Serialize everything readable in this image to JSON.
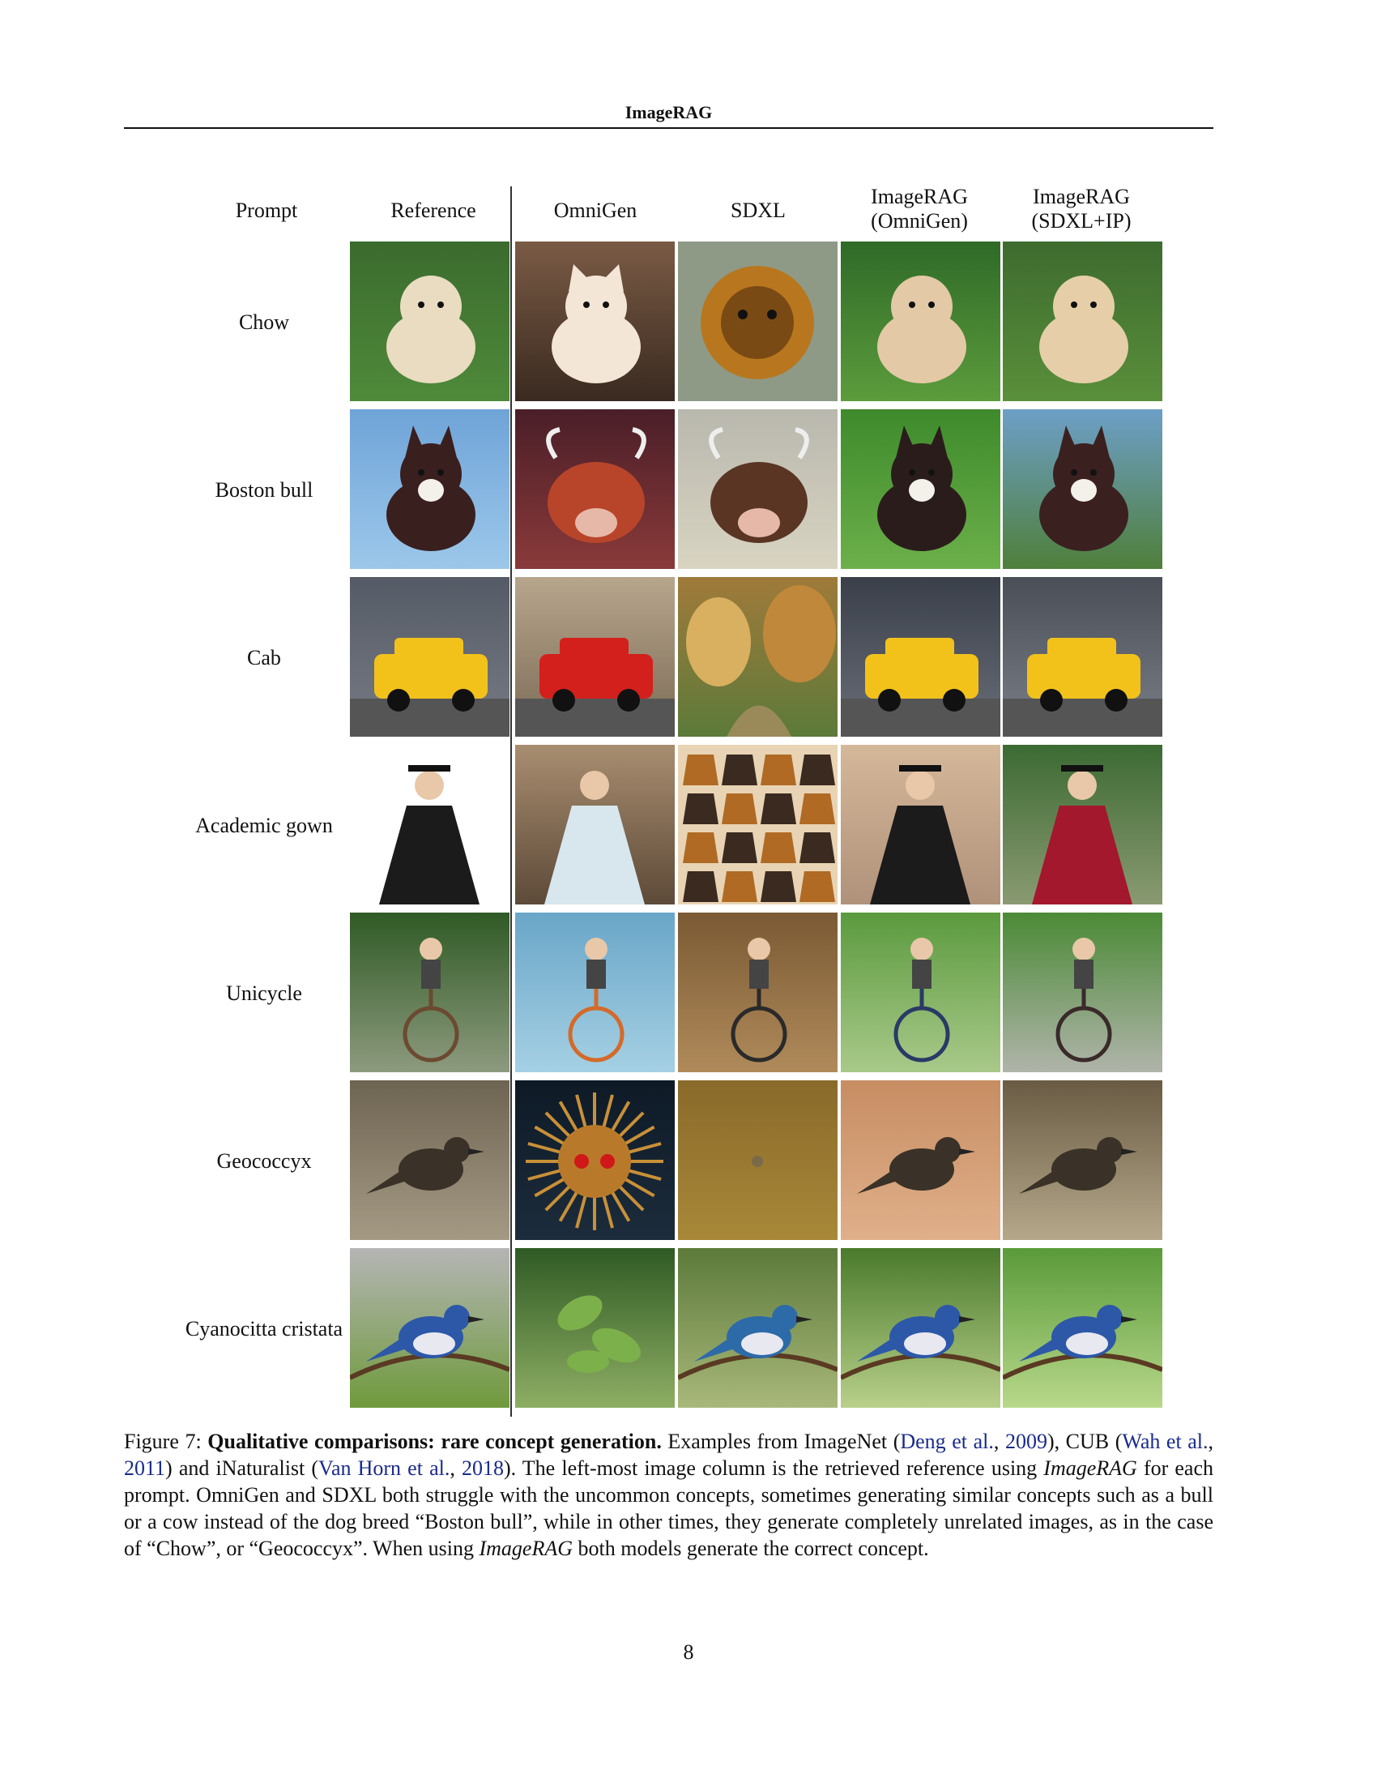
{
  "header": {
    "title": "ImageRAG"
  },
  "figure": {
    "columns": {
      "prompt": "Prompt",
      "reference": "Reference",
      "omnigen": "OmniGen",
      "sdxl": "SDXL",
      "imagerag_omnigen_line1": "ImageRAG",
      "imagerag_omnigen_line2": "(OmniGen)",
      "imagerag_sdxl_line1": "ImageRAG",
      "imagerag_sdxl_line2": "(SDXL+IP)"
    },
    "rows": [
      {
        "prompt": "Chow",
        "images": [
          "chow dog (reference)",
          "white kitten",
          "tiger emblem",
          "chow puppy in garden",
          "chow dog on lawn"
        ]
      },
      {
        "prompt": "Boston bull",
        "images": [
          "boston terrier on canvas",
          "red bull",
          "cow face painting",
          "boston terrier sitting on grass",
          "boston terrier on grass"
        ]
      },
      {
        "prompt": "Cab",
        "images": [
          "yellow cabs in street",
          "red vintage truck",
          "autumn landscape painting",
          "yellow cab on city street",
          "yellow cabs in city"
        ]
      },
      {
        "prompt": "Academic gown",
        "images": [
          "person in academic gown",
          "woman in white gown",
          "pattern of gowns",
          "graduate in cap and gown",
          "red graduation gown"
        ]
      },
      {
        "prompt": "Unicycle",
        "images": [
          "man on penny-farthing",
          "girl on bicycle",
          "bicycle on floor",
          "man on unicycle in park",
          "man on unicycle on path"
        ]
      },
      {
        "prompt": "Geococcyx",
        "images": [
          "roadrunner photo",
          "spiky fluffy creature",
          "sandy texture",
          "roadrunner in desert",
          "roadrunner on ground"
        ]
      },
      {
        "prompt": "Cyanocitta cristata",
        "images": [
          "blue jay on branch",
          "green leaves",
          "blue bird on twig",
          "blue jay among blossoms",
          "blue jay on blossom branch"
        ]
      }
    ]
  },
  "caption": {
    "figure_label": "Figure 7:",
    "bold_title": "Qualitative comparisons: rare concept generation.",
    "text_1": "Examples from ImageNet (",
    "cite_1_author": "Deng et al.",
    "sep_1": ", ",
    "cite_1_year": "2009",
    "text_2": "), CUB (",
    "cite_2_author": "Wah et al.",
    "sep_2": ", ",
    "cite_2_year": "2011",
    "text_3": ") and iNaturalist (",
    "cite_3_author": "Van Horn et al.",
    "sep_3": ", ",
    "cite_3_year": "2018",
    "text_4": "). The left-most image column is the retrieved reference using ",
    "italic_1": "ImageRAG",
    "text_5": " for each prompt. OmniGen and SDXL both struggle with the uncommon concepts, sometimes generating similar concepts such as a bull or a cow instead of the dog breed “Boston bull”, while in other times, they generate completely unrelated images, as in the case of “Chow”, or “Geococcyx”. When using ",
    "italic_2": "ImageRAG",
    "text_6": " both models generate the correct concept."
  },
  "page_number": "8"
}
